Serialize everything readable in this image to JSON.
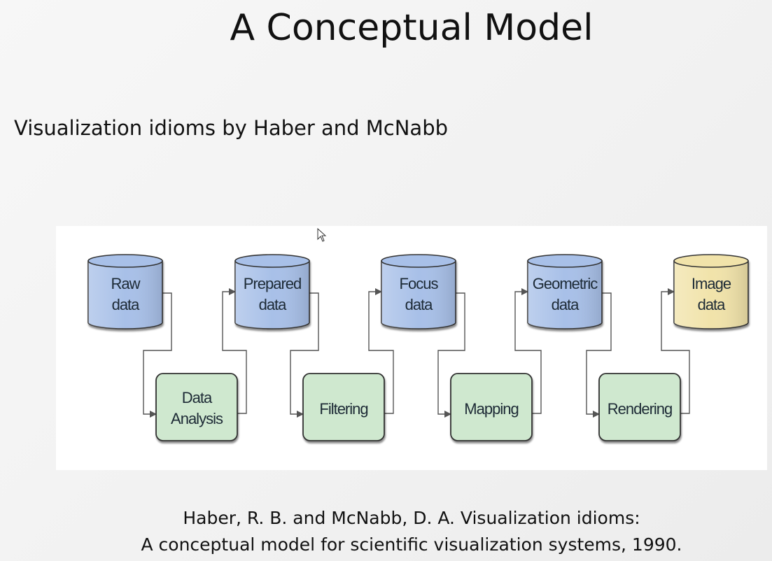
{
  "slide": {
    "title": "A Conceptual Model",
    "subtitle": "Visualization idioms by Haber and McNabb",
    "citation_line1": "Haber, R. B. and McNabb, D. A. Visualization idioms:",
    "citation_line2": "A conceptual model for scientific visualization systems, 1990."
  },
  "diagram": {
    "data_stores": [
      {
        "line1": "Raw",
        "line2": "data",
        "fill": "#a8c0e8"
      },
      {
        "line1": "Prepared",
        "line2": "data",
        "fill": "#a8c0e8"
      },
      {
        "line1": "Focus",
        "line2": "data",
        "fill": "#a8c0e8"
      },
      {
        "line1": "Geometric",
        "line2": "data",
        "fill": "#a8c0e8"
      },
      {
        "line1": "Image",
        "line2": "data",
        "fill": "#f1e3aa"
      }
    ],
    "processes": [
      {
        "line1": "Data",
        "line2": "Analysis"
      },
      {
        "line1": "Filtering",
        "line2": ""
      },
      {
        "line1": "Mapping",
        "line2": ""
      },
      {
        "line1": "Rendering",
        "line2": ""
      }
    ],
    "colors": {
      "process_fill": "#cfe8cf",
      "connector": "#555555"
    }
  }
}
